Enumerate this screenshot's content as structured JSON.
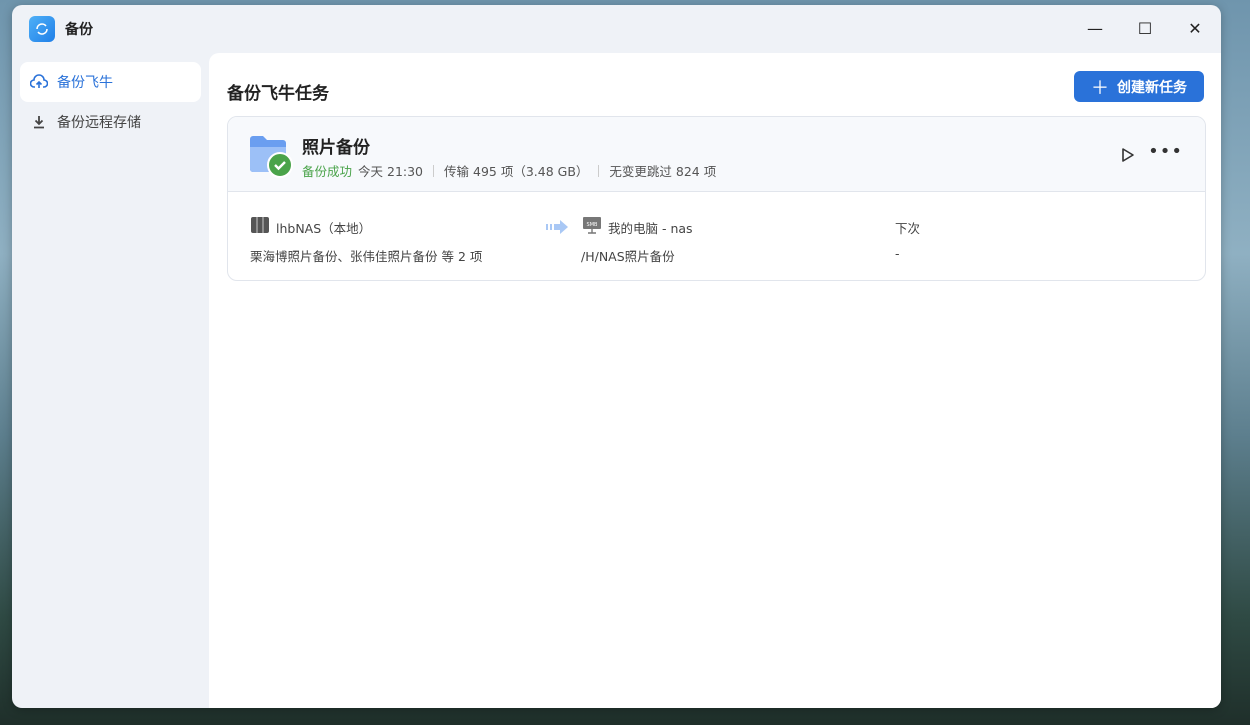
{
  "window": {
    "title": "备份"
  },
  "sidebar": {
    "items": [
      {
        "label": "备份飞牛",
        "active": true
      },
      {
        "label": "备份远程存储",
        "active": false
      }
    ]
  },
  "main": {
    "title": "备份飞牛任务",
    "create_label": "创建新任务"
  },
  "task": {
    "name": "照片备份",
    "status": "备份成功",
    "time": "今天 21:30",
    "transfer": "传输 495 项（3.48 GB）",
    "skipped": "无变更跳过 824 项",
    "source": {
      "device": "lhbNAS（本地）",
      "items": "栗海博照片备份、张伟佳照片备份 等 2 项"
    },
    "target": {
      "device": "我的电脑 - nas",
      "path": "/H/NAS照片备份"
    },
    "next": {
      "label": "下次",
      "value": "-"
    }
  },
  "colors": {
    "accent": "#2a72d9",
    "success": "#4aa34a"
  }
}
